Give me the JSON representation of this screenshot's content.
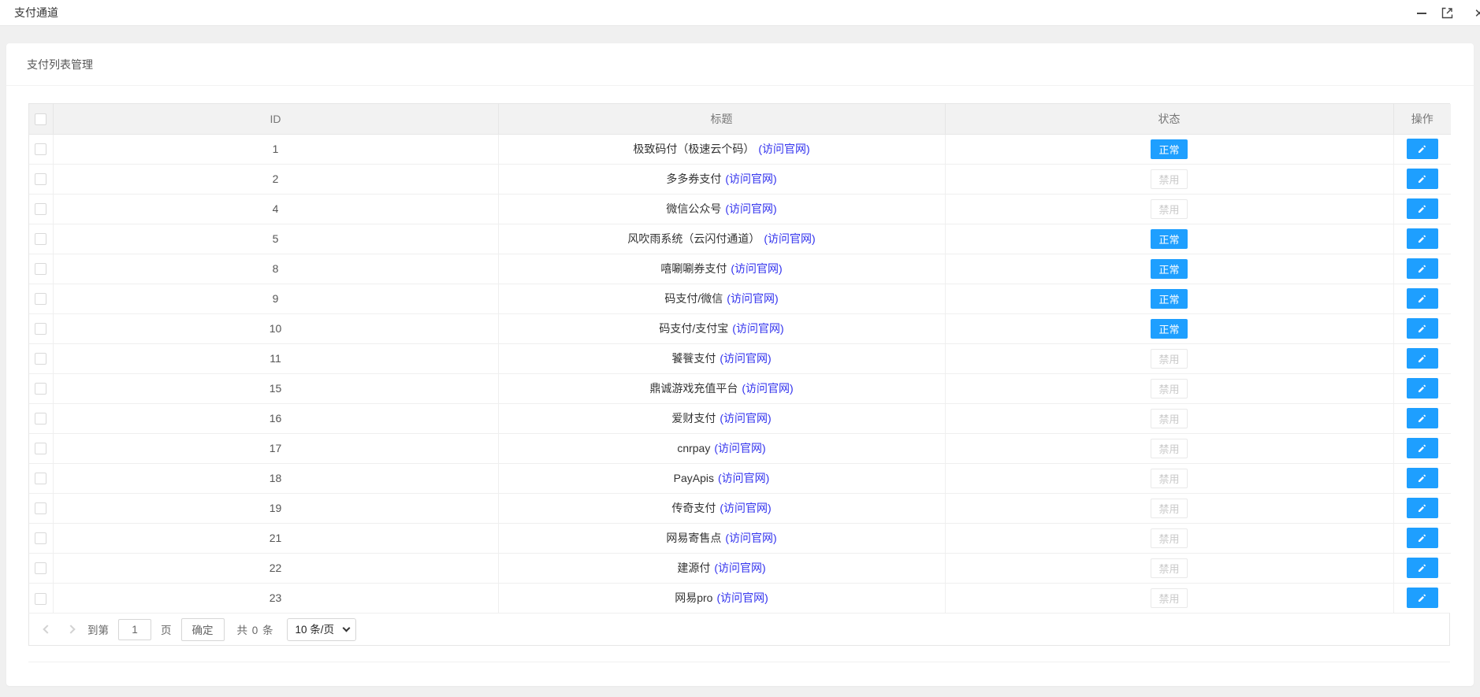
{
  "window": {
    "title": "支付通道"
  },
  "card": {
    "title": "支付列表管理"
  },
  "table": {
    "headers": {
      "id": "ID",
      "title": "标题",
      "status": "状态",
      "action": "操作"
    },
    "link_label": "(访问官网)",
    "status_labels": {
      "normal": "正常",
      "disabled": "禁用"
    },
    "rows": [
      {
        "id": "1",
        "title": "极致码付（极速云个码）",
        "status": "normal"
      },
      {
        "id": "2",
        "title": "多多券支付",
        "status": "disabled"
      },
      {
        "id": "4",
        "title": "微信公众号",
        "status": "disabled"
      },
      {
        "id": "5",
        "title": "风吹雨系统（云闪付通道）",
        "status": "normal"
      },
      {
        "id": "8",
        "title": "嘻唰唰券支付",
        "status": "normal"
      },
      {
        "id": "9",
        "title": "码支付/微信",
        "status": "normal"
      },
      {
        "id": "10",
        "title": "码支付/支付宝",
        "status": "normal"
      },
      {
        "id": "11",
        "title": "饕餮支付",
        "status": "disabled"
      },
      {
        "id": "15",
        "title": "鼎诚游戏充值平台",
        "status": "disabled"
      },
      {
        "id": "16",
        "title": "爱财支付",
        "status": "disabled"
      },
      {
        "id": "17",
        "title": "cnrpay",
        "status": "disabled"
      },
      {
        "id": "18",
        "title": "PayApis",
        "status": "disabled"
      },
      {
        "id": "19",
        "title": "传奇支付",
        "status": "disabled"
      },
      {
        "id": "21",
        "title": "网易寄售点",
        "status": "disabled"
      },
      {
        "id": "22",
        "title": "建源付",
        "status": "disabled"
      },
      {
        "id": "23",
        "title": "网易pro",
        "status": "disabled"
      }
    ]
  },
  "pagination": {
    "goto_label": "到第",
    "page_value": "1",
    "page_unit": "页",
    "confirm_label": "确定",
    "total_label": "共 0 条",
    "page_size": "10 条/页"
  },
  "colors": {
    "accent": "#1E9FFF",
    "link": "#3232EE",
    "page_bg": "#f0f0f0",
    "header_bg": "#f2f2f2",
    "border": "#e6e6e6",
    "disabled_text": "#c9c9c9"
  },
  "icons": {
    "minimize": "minimize-icon",
    "maximize": "maximize-icon",
    "close": "close-icon",
    "edit": "pencil-icon",
    "prev": "chevron-left-icon",
    "next": "chevron-right-icon",
    "select": "chevron-down-icon"
  }
}
